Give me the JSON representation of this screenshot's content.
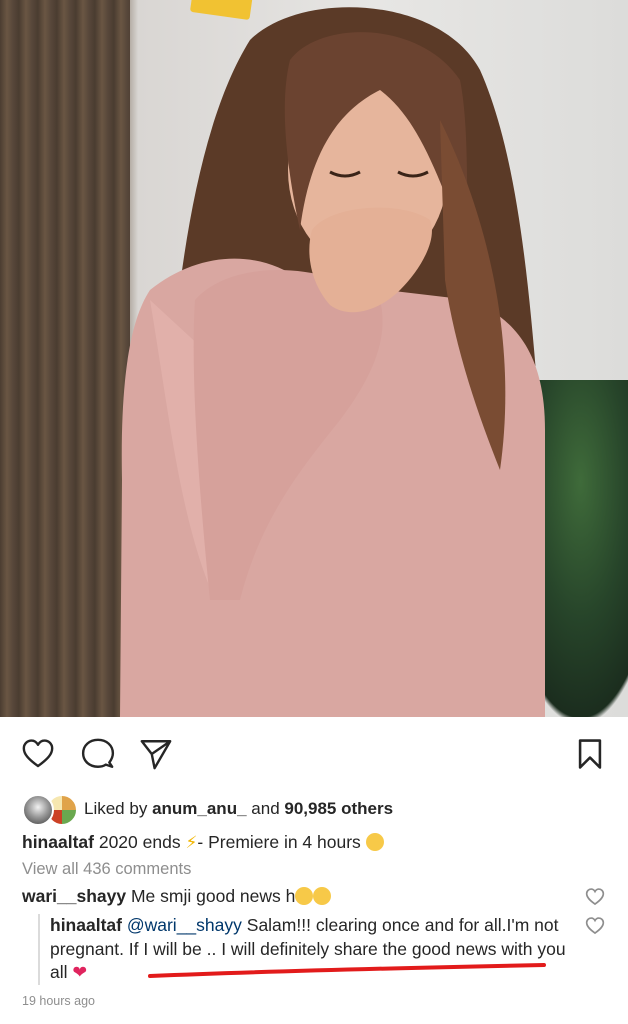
{
  "post": {
    "likes": {
      "prefix": "Liked by",
      "user": "anum_anu_",
      "conjunction": "and",
      "others": "90,985 others"
    },
    "caption": {
      "username": "hinaaltaf",
      "text_before": "2020 ends",
      "text_after": "- Premiere in 4 hours"
    },
    "view_all_comments": "View all 436 comments",
    "comment": {
      "username": "wari__shayy",
      "text": "Me smji good news h"
    },
    "reply": {
      "username": "hinaaltaf",
      "mention": "@wari__shayy",
      "text": "Salam!!! clearing once and for all.I'm not pregnant. If I will be .. I will definitely share the good news with you all"
    },
    "timestamp": "19 hours ago"
  },
  "icons": {
    "like": "heart-outline-icon",
    "comment": "comment-bubble-icon",
    "share": "paper-plane-icon",
    "save": "bookmark-icon",
    "red_heart": "red-heart-icon"
  },
  "colors": {
    "text": "#262626",
    "muted": "#8e8e8e",
    "mention": "#00376b",
    "underline": "#e21b1b",
    "heart": "#e0245e"
  }
}
